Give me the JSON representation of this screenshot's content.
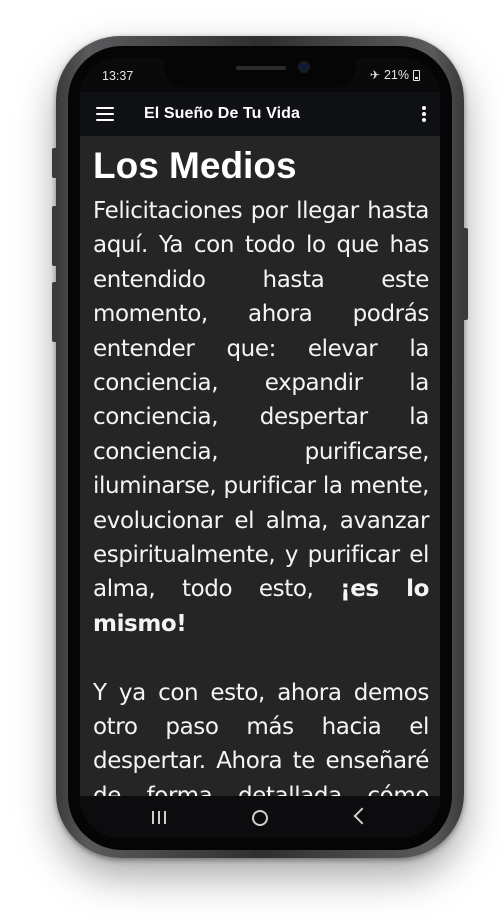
{
  "status": {
    "time": "13:37",
    "battery": "21%",
    "airplane_icon": "airplane-icon"
  },
  "appbar": {
    "title": "El Sueño De Tu Vida",
    "menu_icon": "menu-icon",
    "more_icon": "more-vert-icon"
  },
  "content": {
    "heading": "Los Medios",
    "p1_text": "Felicitaciones por llegar hasta aquí. Ya con todo lo que has entendido hasta este momento, ahora podrás entender que: elevar la conciencia, expandir la conciencia, despertar la conciencia, purificarse, iluminarse, purificar la mente, evolucionar el alma, avanzar espiritualmente, y purificar el alma, todo esto, ",
    "p1_bold": "¡es lo mismo!",
    "p2_text": "Y ya con esto, ahora demos otro paso más hacia el despertar. Ahora te enseñaré de forma detallada cómo aplicar algunas de las vías que generan la Ecuanimidad"
  },
  "navbar": {
    "recent_icon": "recent-apps-icon",
    "home_icon": "home-icon",
    "back_icon": "back-icon"
  },
  "colors": {
    "content_bg": "#252525",
    "appbar_bg": "#101115",
    "text": "#ffffff"
  }
}
